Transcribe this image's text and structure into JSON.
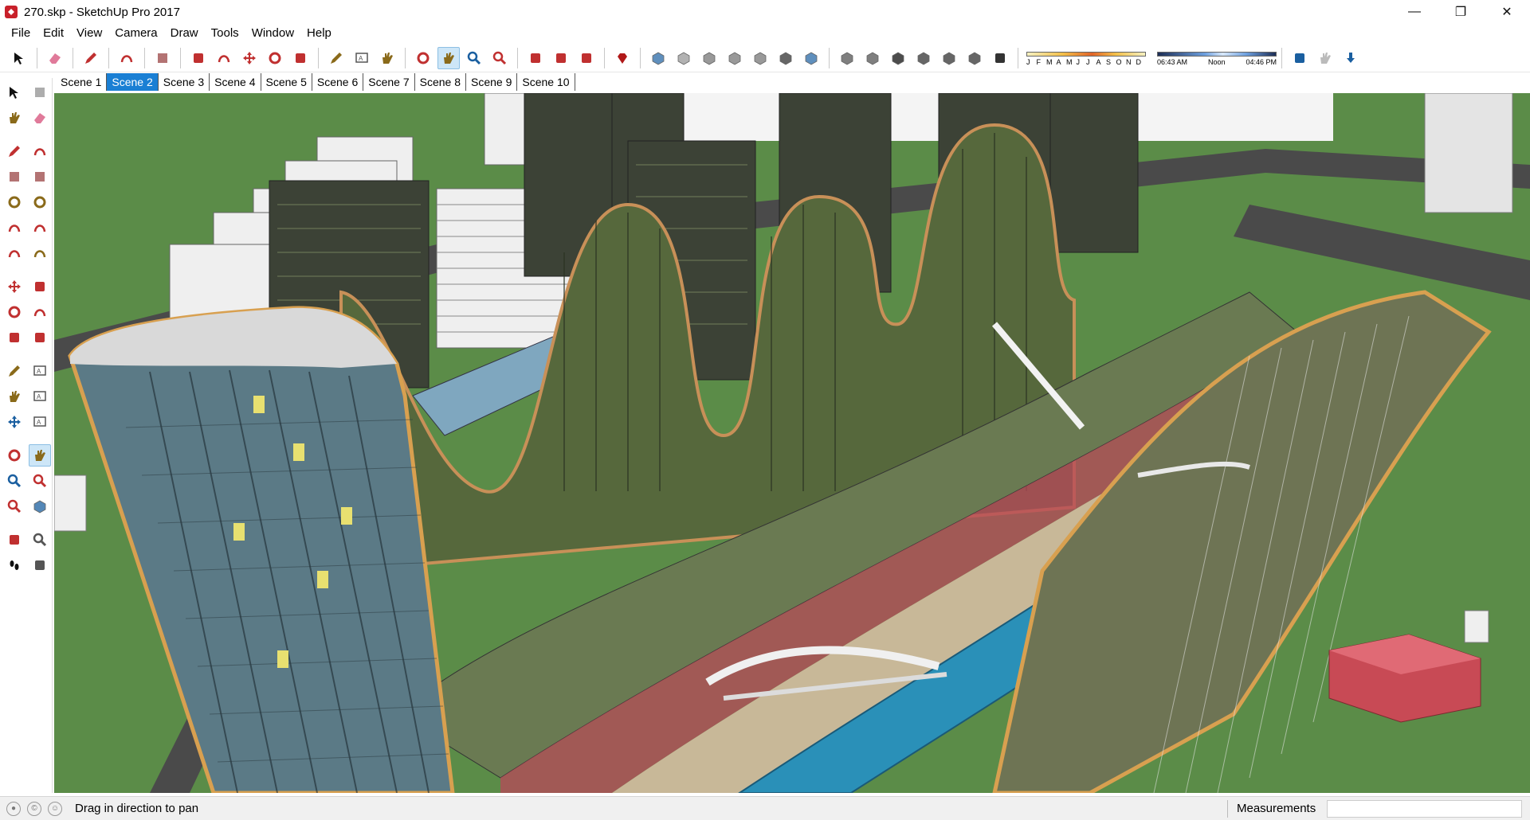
{
  "window": {
    "title": "270.skp - SketchUp Pro 2017",
    "controls": {
      "minimize": "—",
      "maximize": "❐",
      "close": "✕"
    }
  },
  "menu": [
    "File",
    "Edit",
    "View",
    "Camera",
    "Draw",
    "Tools",
    "Window",
    "Help"
  ],
  "toolbar": {
    "tools": [
      {
        "icon": "select-arrow-icon",
        "color": "#111111"
      },
      {
        "icon": "eraser-icon",
        "color": "#e07a9a"
      },
      {
        "icon": "pencil-line-icon",
        "color": "#c03030"
      },
      {
        "icon": "freehand-icon",
        "color": "#c03030"
      },
      {
        "icon": "rectangle-icon",
        "color": "#a05050"
      },
      {
        "icon": "push-pull-icon",
        "color": "#c03030"
      },
      {
        "icon": "follow-me-icon",
        "color": "#c03030"
      },
      {
        "icon": "move-icon",
        "color": "#c03030"
      },
      {
        "icon": "rotate-icon",
        "color": "#c03030"
      },
      {
        "icon": "scale-icon",
        "color": "#c03030"
      },
      {
        "icon": "tape-measure-icon",
        "color": "#8a6a1a"
      },
      {
        "icon": "text-icon",
        "color": "#555555"
      },
      {
        "icon": "paint-bucket-icon",
        "color": "#8a6a1a"
      },
      {
        "icon": "orbit-icon",
        "color": "#c03030"
      },
      {
        "icon": "pan-hand-icon",
        "color": "#8a6a1a"
      },
      {
        "icon": "zoom-icon",
        "color": "#1a5fa0"
      },
      {
        "icon": "zoom-extents-icon",
        "color": "#c03030"
      },
      {
        "icon": "warehouse-icon",
        "color": "#c03030"
      },
      {
        "icon": "extension-warehouse-icon",
        "color": "#c03030"
      },
      {
        "icon": "layout-send-icon",
        "color": "#c03030"
      },
      {
        "icon": "ruby-icon",
        "color": "#b01818"
      },
      {
        "icon": "xray-style-icon",
        "color": "#2a6aa8"
      },
      {
        "icon": "backedges-style-icon",
        "color": "#999999"
      },
      {
        "icon": "wireframe-style-icon",
        "color": "#777777"
      },
      {
        "icon": "hiddenline-style-icon",
        "color": "#777777"
      },
      {
        "icon": "shaded-style-icon",
        "color": "#777777"
      },
      {
        "icon": "shaded-textures-style-icon",
        "color": "#333333"
      },
      {
        "icon": "monochrome-style-icon",
        "color": "#2a6aa8"
      },
      {
        "icon": "iso-view-icon",
        "color": "#555555"
      },
      {
        "icon": "top-view-icon",
        "color": "#555555"
      },
      {
        "icon": "front-view-icon",
        "color": "#111111"
      },
      {
        "icon": "right-view-icon",
        "color": "#333333"
      },
      {
        "icon": "back-view-icon",
        "color": "#333333"
      },
      {
        "icon": "left-view-icon",
        "color": "#333333"
      },
      {
        "icon": "shadows-toggle-icon",
        "color": "#333333"
      }
    ],
    "active_tool": "pan-hand-icon",
    "shadow_months": [
      "J",
      "F",
      "M",
      "A",
      "M",
      "J",
      "J",
      "A",
      "S",
      "O",
      "N",
      "D"
    ],
    "shadow_time": {
      "start": "06:43 AM",
      "mid": "Noon",
      "end": "04:46 PM"
    },
    "extra_tools": [
      {
        "icon": "model-info-icon",
        "color": "#1a5fa0"
      },
      {
        "icon": "hand-pointer-icon",
        "color": "#bbbbbb"
      },
      {
        "icon": "download-arrow-icon",
        "color": "#1a5fa0"
      }
    ]
  },
  "scenes": {
    "tabs": [
      "Scene 1",
      "Scene 2",
      "Scene 3",
      "Scene 4",
      "Scene 5",
      "Scene 6",
      "Scene 7",
      "Scene 8",
      "Scene 9",
      "Scene 10"
    ],
    "active": "Scene 2"
  },
  "palette": [
    {
      "icon": "select-arrow-icon",
      "color": "#111111"
    },
    {
      "icon": "make-component-icon",
      "color": "#999999"
    },
    {
      "icon": "paint-bucket-icon",
      "color": "#8a6a1a"
    },
    {
      "icon": "eraser-icon",
      "color": "#e07a9a"
    },
    {
      "icon": "pencil-line-icon",
      "color": "#c03030"
    },
    {
      "icon": "freehand-icon",
      "color": "#c03030"
    },
    {
      "icon": "rectangle-icon",
      "color": "#a05050"
    },
    {
      "icon": "rotated-rectangle-icon",
      "color": "#a05050"
    },
    {
      "icon": "circle-icon",
      "color": "#8a6a1a"
    },
    {
      "icon": "polygon-icon",
      "color": "#8a6a1a"
    },
    {
      "icon": "arc-icon",
      "color": "#c03030"
    },
    {
      "icon": "two-point-arc-icon",
      "color": "#c03030"
    },
    {
      "icon": "three-point-arc-icon",
      "color": "#c03030"
    },
    {
      "icon": "pie-icon",
      "color": "#8a6a1a"
    },
    {
      "icon": "move-icon",
      "color": "#c03030"
    },
    {
      "icon": "push-pull-icon",
      "color": "#c03030"
    },
    {
      "icon": "rotate-icon",
      "color": "#c03030"
    },
    {
      "icon": "follow-me-icon",
      "color": "#c03030"
    },
    {
      "icon": "scale-icon",
      "color": "#c03030"
    },
    {
      "icon": "offset-icon",
      "color": "#c03030"
    },
    {
      "icon": "tape-measure-icon",
      "color": "#8a6a1a"
    },
    {
      "icon": "dimension-icon",
      "color": "#555555"
    },
    {
      "icon": "protractor-icon",
      "color": "#8a6a1a"
    },
    {
      "icon": "text-icon",
      "color": "#555555"
    },
    {
      "icon": "axes-icon",
      "color": "#1a5fa0"
    },
    {
      "icon": "3d-text-icon",
      "color": "#555555"
    },
    {
      "icon": "orbit-icon",
      "color": "#c03030"
    },
    {
      "icon": "pan-hand-icon",
      "color": "#8a6a1a"
    },
    {
      "icon": "zoom-icon",
      "color": "#1a5fa0"
    },
    {
      "icon": "zoom-window-icon",
      "color": "#c03030"
    },
    {
      "icon": "zoom-extents-icon",
      "color": "#c03030"
    },
    {
      "icon": "previous-view-icon",
      "color": "#1a5fa0"
    },
    {
      "icon": "position-camera-icon",
      "color": "#c03030"
    },
    {
      "icon": "look-around-icon",
      "color": "#555555"
    },
    {
      "icon": "walk-footprints-icon",
      "color": "#111111"
    },
    {
      "icon": "section-plane-icon",
      "color": "#555555"
    }
  ],
  "palette_active": "pan-hand-icon",
  "viewport": {
    "ground_color": "#5b8c48",
    "water_color": "#2a90b8",
    "road_color": "#4a4a4a",
    "facade_color": "#5a6a52",
    "glass_color": "#7fa7bf",
    "accent_orange": "#d8a050"
  },
  "status": {
    "hint": "Drag in direction to pan",
    "measurements_label": "Measurements",
    "measurements_value": ""
  }
}
